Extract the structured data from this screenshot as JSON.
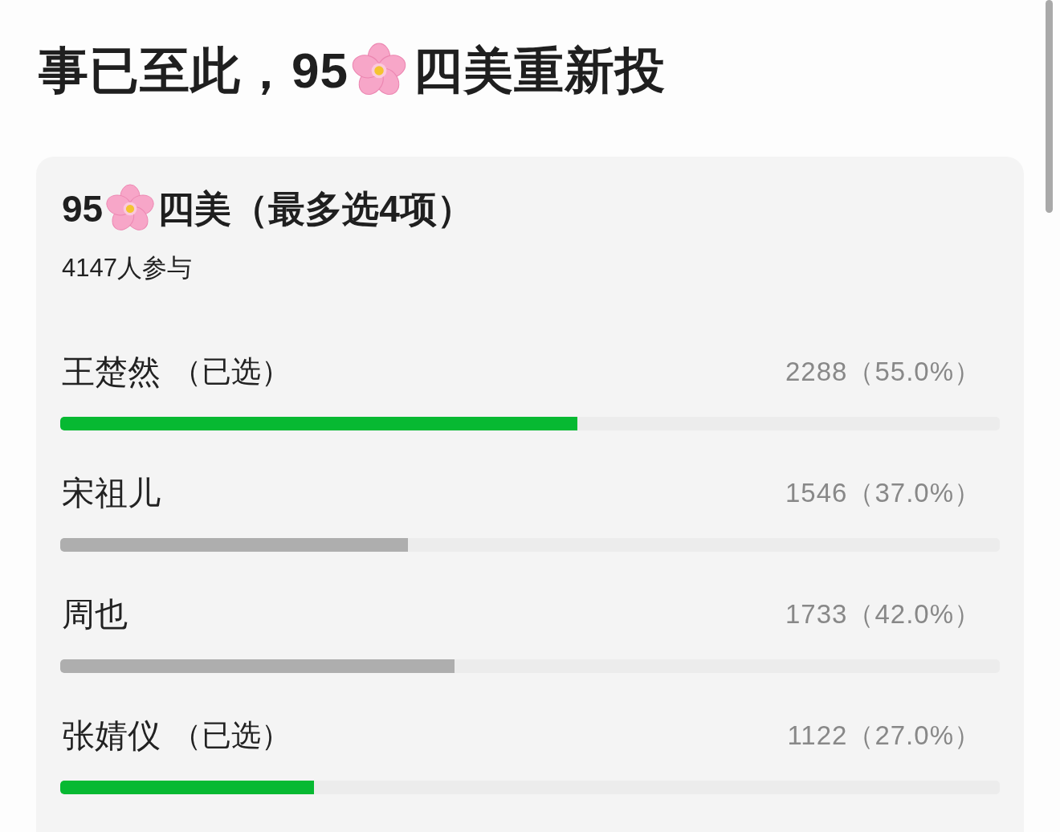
{
  "page_title": {
    "text_before": "事已至此，95",
    "text_after": "四美重新投"
  },
  "poll": {
    "title_before": "95",
    "title_after": "四美（最多选4项）",
    "participants": "4147人参与",
    "options": [
      {
        "name": "王楚然",
        "tag": "（已选）",
        "selected": true,
        "result": "2288（55.0%）",
        "level": 0.55
      },
      {
        "name": "宋祖儿",
        "selected": false,
        "result": "1546（37.0%）",
        "level": 0.37
      },
      {
        "name": "周也",
        "selected": false,
        "result": "1733（42.0%）",
        "level": 0.42
      },
      {
        "name": "张婧仪",
        "tag": "（已选）",
        "selected": true,
        "result": "1122（27.0%）",
        "level": 0.27
      }
    ]
  }
}
